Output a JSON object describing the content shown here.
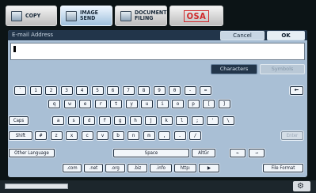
{
  "tabs": [
    {
      "label": "COPY",
      "active": false
    },
    {
      "label": "IMAGE SEND",
      "active": true
    },
    {
      "label": "DOCUMENT FILING",
      "active": false
    },
    {
      "label": "OSA",
      "active": false
    }
  ],
  "panel": {
    "title": "E-mail Address",
    "cancel_label": "Cancel",
    "ok_label": "OK",
    "input_value": "",
    "mode_characters": "Characters",
    "mode_symbols": "Symbols"
  },
  "keyboard": {
    "row1": [
      "`",
      "1",
      "2",
      "3",
      "4",
      "5",
      "6",
      "7",
      "8",
      "9",
      "0",
      "-",
      "=",
      "←"
    ],
    "row2": [
      "q",
      "w",
      "e",
      "r",
      "t",
      "y",
      "u",
      "i",
      "o",
      "p",
      "[",
      "]"
    ],
    "row3": [
      "Caps",
      "a",
      "s",
      "d",
      "f",
      "g",
      "h",
      "j",
      "k",
      "l",
      ";",
      "'",
      "\\"
    ],
    "row4": [
      "Shift",
      "#",
      "z",
      "x",
      "c",
      "v",
      "b",
      "n",
      "m",
      ",",
      ".",
      "/",
      "Enter"
    ],
    "row5": [
      "Other Language",
      "Space",
      "AltGr",
      "←",
      "→"
    ],
    "row6": [
      ".com",
      ".net",
      ".org",
      ".biz",
      ".info",
      "http:",
      "▶",
      "File Format"
    ]
  },
  "colors": {
    "panel_bg": "#a9bfd5",
    "title_bar": "#22354a",
    "page_bg": "#0c1416"
  },
  "icons": {
    "backspace": "backspace-arrow-icon",
    "gear": "gear-icon"
  },
  "gear_glyph": "⚙"
}
